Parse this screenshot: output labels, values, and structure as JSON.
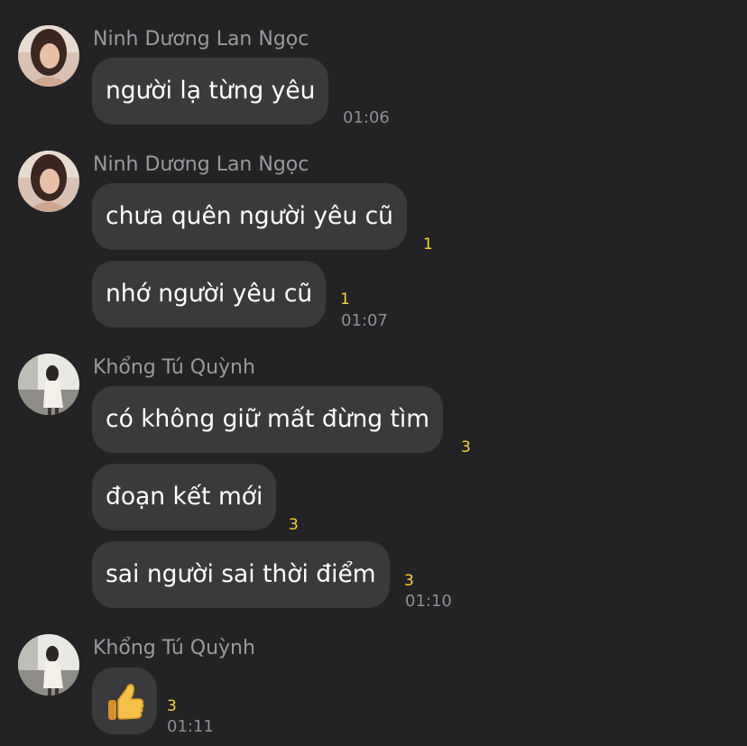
{
  "messages": [
    {
      "sender": "Ninh Dương Lan Ngọc",
      "items": [
        {
          "text": "người lạ từng yêu",
          "time": "01:06"
        }
      ]
    },
    {
      "sender": "Ninh Dương Lan Ngọc",
      "items": [
        {
          "text": "chưa quên người yêu cũ",
          "count": "1"
        },
        {
          "text": "nhớ người yêu cũ",
          "count": "1",
          "time": "01:07"
        }
      ]
    },
    {
      "sender": "Khổng Tú Quỳnh",
      "items": [
        {
          "text": "có không giữ mất đừng tìm",
          "count": "3"
        },
        {
          "text": "đoạn kết mới",
          "count": "3"
        },
        {
          "text": "sai người sai thời điểm",
          "count": "3",
          "time": "01:10"
        }
      ]
    },
    {
      "sender": "Khổng Tú Quỳnh",
      "items": [
        {
          "emoji": "thumbs-up",
          "count": "3",
          "time": "01:11"
        }
      ]
    }
  ],
  "colors": {
    "background": "#232325",
    "bubble": "#3a3a3c",
    "count": "#f5d43b",
    "meta": "#8e8e93"
  }
}
